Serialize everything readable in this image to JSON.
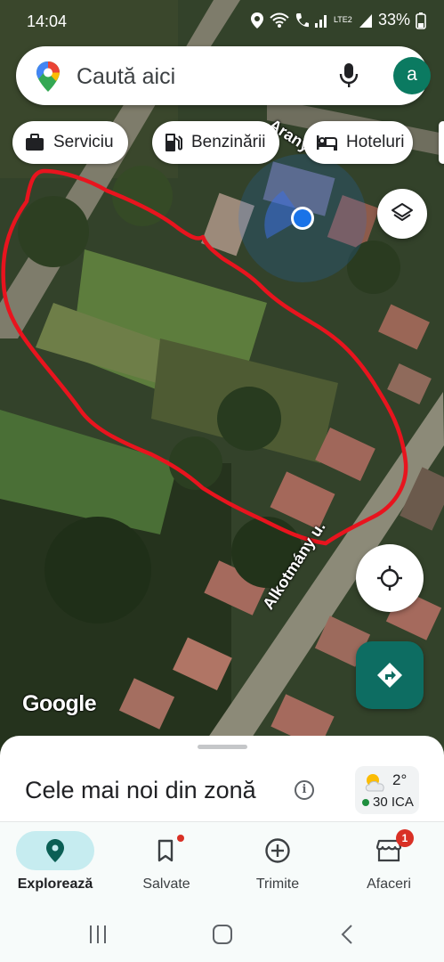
{
  "status_bar": {
    "time": "14:04",
    "battery": "33%",
    "network": "LTE2"
  },
  "search": {
    "placeholder": "Caută aici",
    "avatar_letter": "a"
  },
  "chips": [
    {
      "label": "Serviciu",
      "icon": "briefcase-icon"
    },
    {
      "label": "Benzinării",
      "icon": "gas-station-icon"
    },
    {
      "label": "Hoteluri",
      "icon": "hotel-bed-icon"
    }
  ],
  "map": {
    "street_1": "Alkotmány u.",
    "street_2": "Arany J.",
    "logo": "Google",
    "drawing_color": "#e8141e",
    "location_color": "#1a73e8"
  },
  "sheet": {
    "title": "Cele mai noi din zonă",
    "weather_temp": "2°",
    "weather_aqi": "30 ICA"
  },
  "nav": {
    "items": [
      {
        "label": "Explorează",
        "icon": "explore-pin-icon",
        "active": true
      },
      {
        "label": "Salvate",
        "icon": "bookmark-icon",
        "active": false
      },
      {
        "label": "Trimite",
        "icon": "add-circle-icon",
        "active": false
      },
      {
        "label": "Afaceri",
        "icon": "store-icon",
        "active": false,
        "badge": "1"
      }
    ]
  }
}
